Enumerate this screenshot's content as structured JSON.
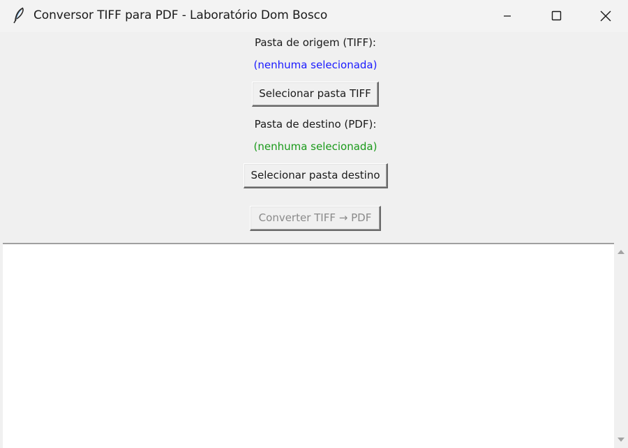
{
  "window": {
    "title": "Conversor TIFF para PDF - Laboratório Dom Bosco",
    "app_icon": "feather-icon",
    "controls": {
      "minimize_icon": "minimize-icon",
      "maximize_icon": "maximize-icon",
      "close_icon": "close-icon"
    }
  },
  "source": {
    "label": "Pasta de origem (TIFF):",
    "path": "(nenhuma selecionada)",
    "path_color": "#1a1aff",
    "button_label": "Selecionar pasta TIFF"
  },
  "destination": {
    "label": "Pasta de destino (PDF):",
    "path": "(nenhuma selecionada)",
    "path_color": "#1a9a1a",
    "button_label": "Selecionar pasta destino"
  },
  "convert": {
    "button_label": "Converter TIFF → PDF",
    "enabled": false
  },
  "log": {
    "text": "",
    "scroll_up_icon": "scroll-up-arrow-icon",
    "scroll_down_icon": "scroll-down-arrow-icon"
  }
}
